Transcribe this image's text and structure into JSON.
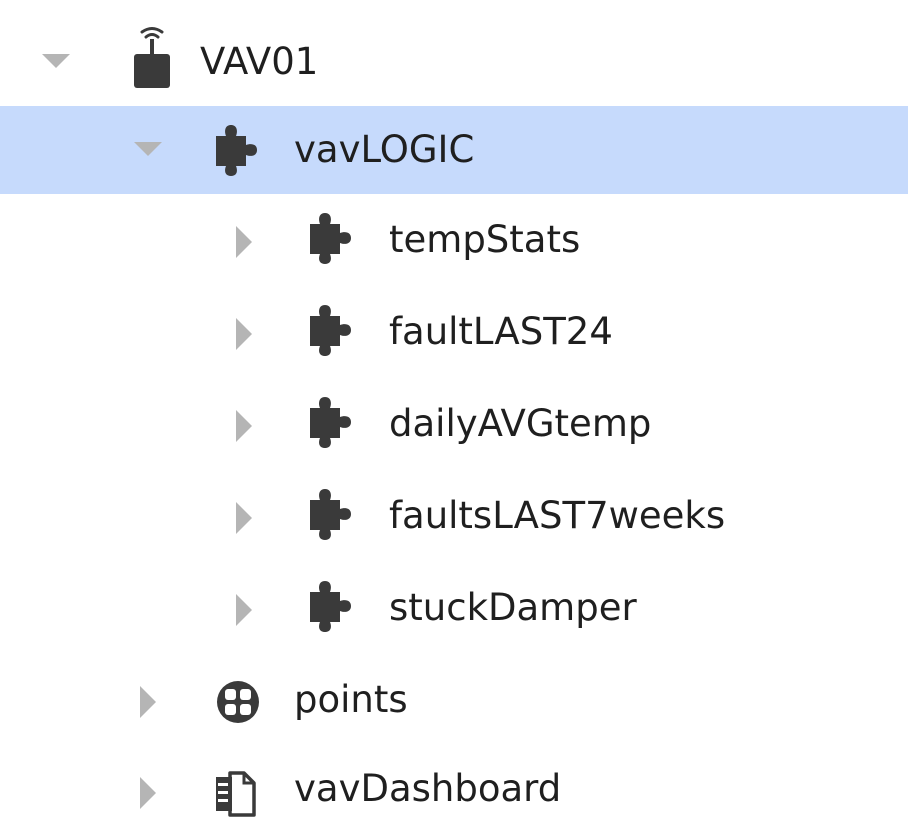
{
  "tree": {
    "root": {
      "label": "VAV01",
      "icon": "wireless-device-icon",
      "expanded": true
    },
    "vavlogic": {
      "label": "vavLOGIC",
      "icon": "puzzle-icon",
      "expanded": true,
      "selected": true
    },
    "children": [
      {
        "label": "tempStats",
        "icon": "puzzle-icon",
        "expanded": false
      },
      {
        "label": "faultLAST24",
        "icon": "puzzle-icon",
        "expanded": false
      },
      {
        "label": "dailyAVGtemp",
        "icon": "puzzle-icon",
        "expanded": false
      },
      {
        "label": "faultsLAST7weeks",
        "icon": "puzzle-icon",
        "expanded": false
      },
      {
        "label": "stuckDamper",
        "icon": "puzzle-icon",
        "expanded": false
      }
    ],
    "points": {
      "label": "points",
      "icon": "points-icon",
      "expanded": false
    },
    "dashboard": {
      "label": "vavDashboard",
      "icon": "document-icon",
      "expanded": false
    },
    "colors": {
      "selection": "#c6dafc",
      "icon": "#3a3a3a",
      "toggle": "#b5b5b5",
      "text": "#1f1f1f"
    }
  }
}
